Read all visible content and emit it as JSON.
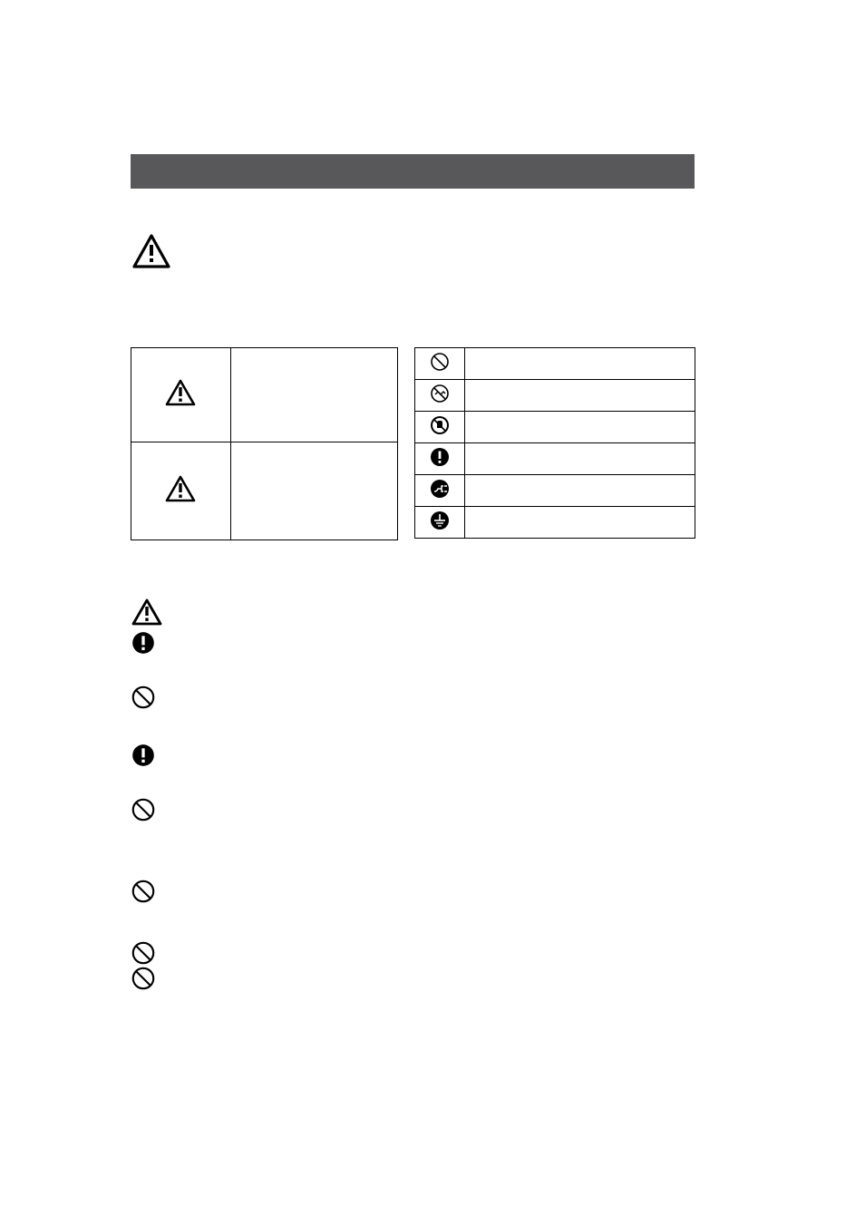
{
  "bar_label": "",
  "large_warning_label": "",
  "table1": {
    "row1_icon": "warning-triangle",
    "row1_text": "",
    "row2_icon": "warning-triangle",
    "row2_text": ""
  },
  "table2": {
    "rows": [
      {
        "icon": "prohibited",
        "text": ""
      },
      {
        "icon": "no-disassemble",
        "text": ""
      },
      {
        "icon": "no-touch",
        "text": ""
      },
      {
        "icon": "mandatory-exclaim",
        "text": ""
      },
      {
        "icon": "unplug",
        "text": ""
      },
      {
        "icon": "ground",
        "text": ""
      }
    ]
  },
  "list_icons": [
    "warning-triangle",
    "mandatory-exclaim",
    "prohibited",
    "mandatory-exclaim",
    "prohibited",
    "prohibited",
    "prohibited",
    "prohibited"
  ]
}
